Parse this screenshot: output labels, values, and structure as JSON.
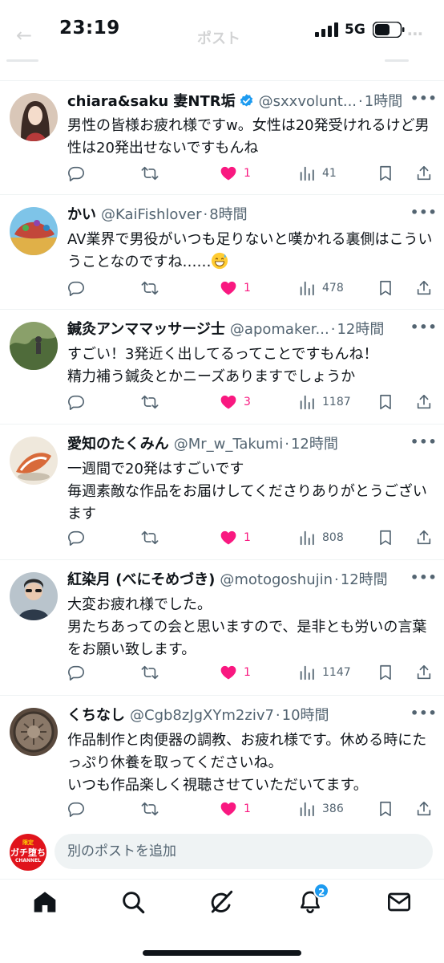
{
  "status_bar": {
    "time": "23:19",
    "network": "5G"
  },
  "header": {
    "title": "ポスト"
  },
  "colors": {
    "like": "#f91880",
    "muted": "#536471",
    "accent": "#1d9bf0",
    "text": "#0f1419"
  },
  "tweets": [
    {
      "name": "chiara&saku 妻NTR垢",
      "verified": true,
      "handle": "@sxxvolunt...",
      "time": "1時間",
      "text": "男性の皆様お疲れ様ですw。女性は20発受けれるけど男性は20発出せないですもんね",
      "replies": "",
      "retweets": "",
      "likes": "1",
      "liked": true,
      "views": "41"
    },
    {
      "name": "かい",
      "verified": false,
      "handle": "@KaiFishlover",
      "time": "8時間",
      "text": "AV業界で男役がいつも足りないと嘆かれる裏側はこういうことなのですね……",
      "emoji": "grinning-sweat-emoji",
      "replies": "",
      "retweets": "",
      "likes": "1",
      "liked": true,
      "views": "478"
    },
    {
      "name": "鍼灸アンママッサージ士",
      "verified": false,
      "handle": "@apomaker...",
      "time": "12時間",
      "text": "すごい！3発近く出してるってことですもんね！\n精力補う鍼灸とかニーズありますでしょうか",
      "replies": "",
      "retweets": "",
      "likes": "3",
      "liked": true,
      "views": "1187"
    },
    {
      "name": "愛知のたくみん",
      "verified": false,
      "handle": "@Mr_w_Takumi",
      "time": "12時間",
      "text": "一週間で20発はすごいです\n毎週素敵な作品をお届けしてくださりありがとうございます",
      "replies": "",
      "retweets": "",
      "likes": "1",
      "liked": true,
      "views": "808"
    },
    {
      "name": "紅染月 (べにそめづき)",
      "verified": false,
      "handle": "@motogoshujin",
      "time": "12時間",
      "text": "大変お疲れ様でした。\n男たちあっての会と思いますので、是非とも労いの言葉をお願い致します。",
      "replies": "",
      "retweets": "",
      "likes": "1",
      "liked": true,
      "views": "1147"
    },
    {
      "name": "くちなし",
      "verified": false,
      "handle": "@Cgb8zJgXYm2ziv7",
      "time": "10時間",
      "text": "作品制作と肉便器の調教、お疲れ様です。休める時にたっぷり休養を取ってくださいね。\nいつも作品楽しく視聴させていただいてます。",
      "replies": "",
      "retweets": "",
      "likes": "1",
      "liked": true,
      "views": "386"
    }
  ],
  "reply_bar": {
    "avatar_top": "限定",
    "avatar_main": "ガチ堕ち",
    "avatar_bottom": "CHANNEL",
    "placeholder": "別のポストを追加"
  },
  "tab_bar": {
    "tabs": [
      "home-icon",
      "search-icon",
      "grok-icon",
      "bell-icon",
      "envelope-icon"
    ],
    "notification_badge": "2"
  }
}
